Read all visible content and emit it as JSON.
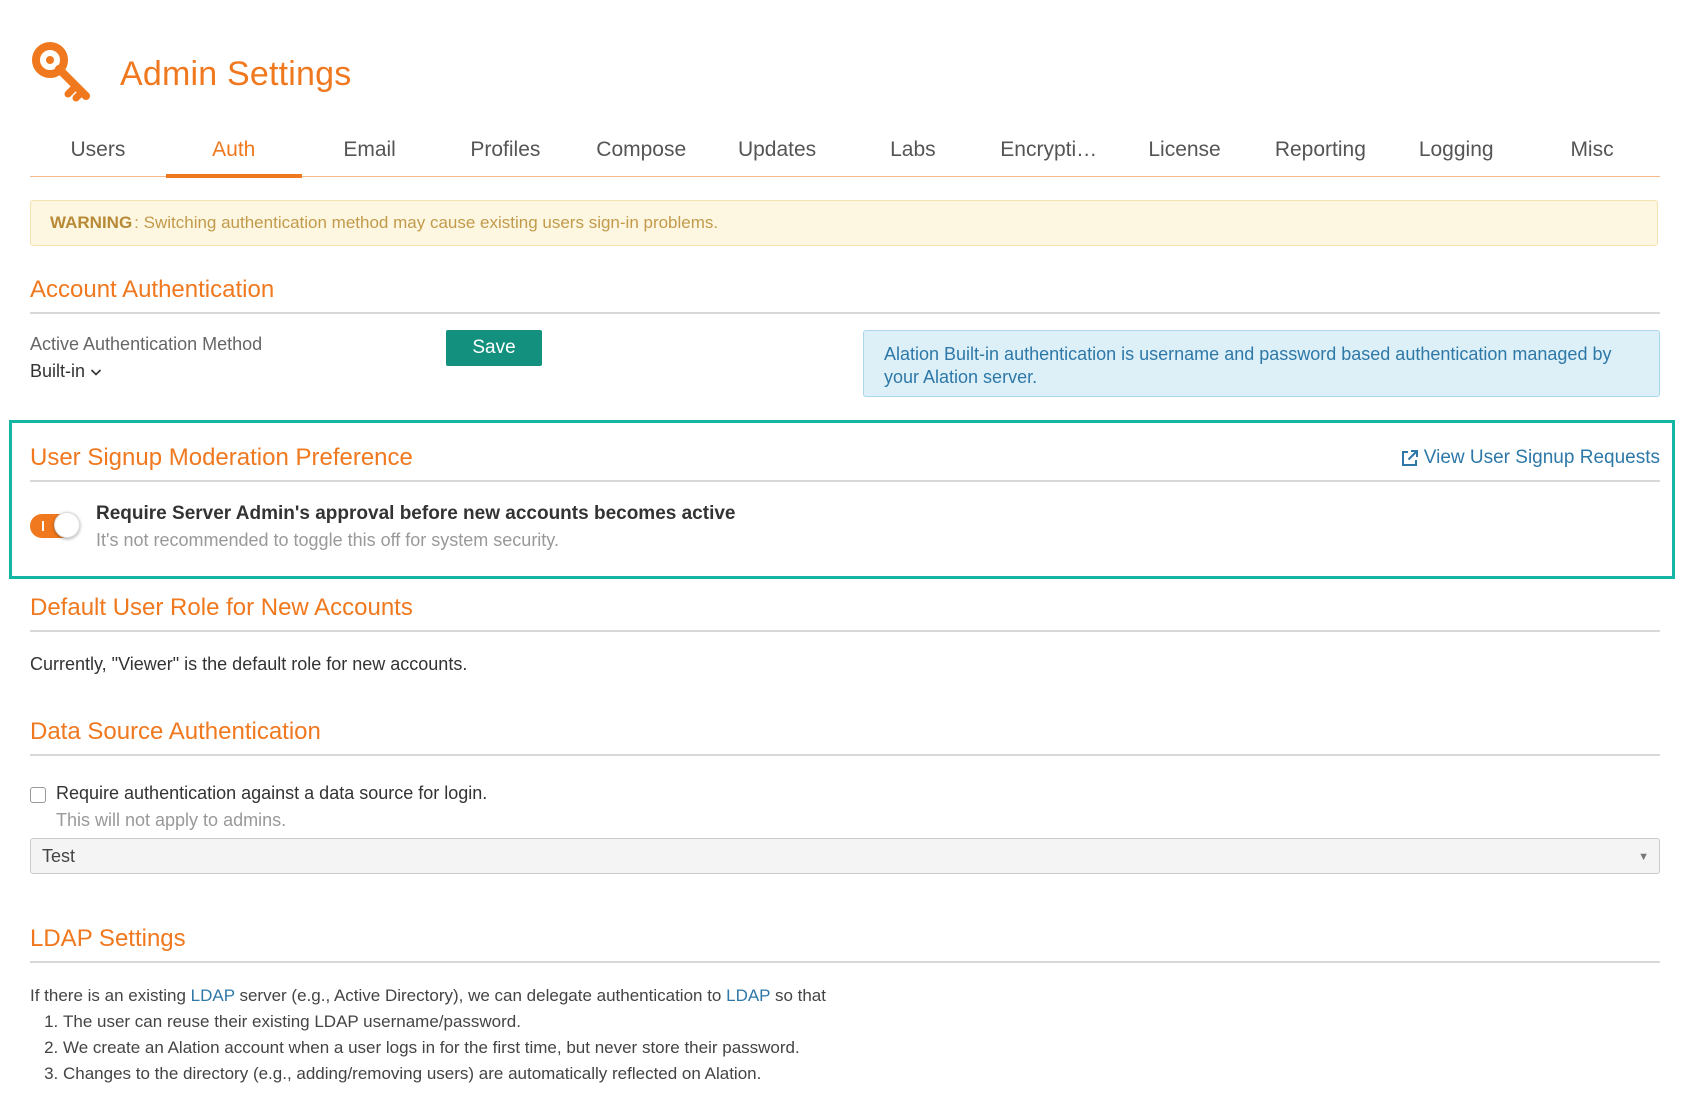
{
  "header": {
    "title": "Admin Settings",
    "icon": "key-icon",
    "accent": "#f0781e"
  },
  "tabs": [
    {
      "label": "Users"
    },
    {
      "label": "Auth",
      "active": true
    },
    {
      "label": "Email"
    },
    {
      "label": "Profiles"
    },
    {
      "label": "Compose"
    },
    {
      "label": "Updates"
    },
    {
      "label": "Labs"
    },
    {
      "label": "Encrypti…"
    },
    {
      "label": "License"
    },
    {
      "label": "Reporting"
    },
    {
      "label": "Logging"
    },
    {
      "label": "Misc"
    }
  ],
  "warning": {
    "label": "WARNING",
    "text": ": Switching authentication method may cause existing users sign-in problems."
  },
  "account_auth": {
    "title": "Account Authentication",
    "method_label": "Active Authentication Method",
    "method_value": "Built-in",
    "save_label": "Save",
    "info": "Alation Built-in authentication is username and password based authentication managed by your Alation server."
  },
  "signup_moderation": {
    "title": "User Signup Moderation Preference",
    "link_label": "View User Signup Requests",
    "toggle_on": true,
    "toggle_label": "Require Server Admin's approval before new accounts becomes active",
    "toggle_help": "It's not recommended to toggle this off for system security."
  },
  "default_role": {
    "title": "Default User Role for New Accounts",
    "text": "Currently, \"Viewer\" is the default role for new accounts."
  },
  "data_source_auth": {
    "title": "Data Source Authentication",
    "checkbox_label": "Require authentication against a data source for login.",
    "checkbox_help": "This will not apply to admins.",
    "select_value": "Test"
  },
  "ldap": {
    "title": "LDAP Settings",
    "intro_1": "If there is an existing ",
    "link_1": "LDAP",
    "intro_2": " server (e.g., Active Directory), we can delegate authentication to ",
    "link_2": "LDAP",
    "intro_3": " so that",
    "items": [
      "The user can reuse their existing LDAP username/password.",
      "We create an Alation account when a user logs in for the first time, but never store their password.",
      "Changes to the directory (e.g., adding/removing users) are automatically reflected on Alation."
    ]
  }
}
